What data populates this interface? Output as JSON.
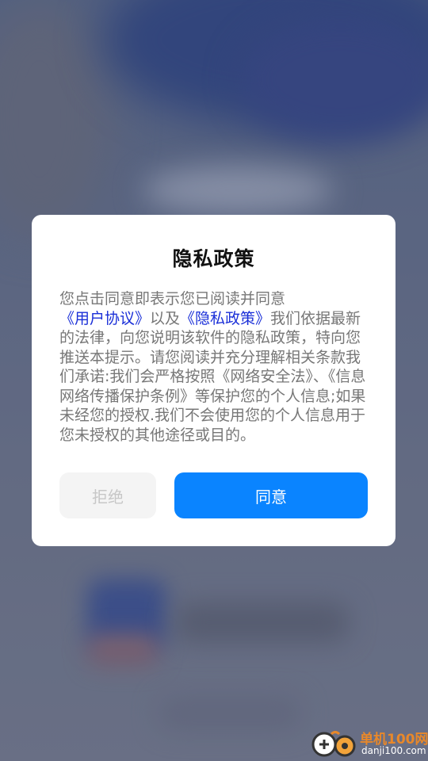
{
  "dialog": {
    "title": "隐私政策",
    "body": {
      "part1": "您点击同意即表示您已阅读并同意",
      "user_agreement_link": "《用户协议》",
      "part2": "以及",
      "privacy_policy_link": "《隐私政策》",
      "part3": "我们依据最新的法律，向您说明该软件的隐私政策，特向您推送本提示。请您阅读并充分理解相关条款我们承诺:我们会严格按照《网络安全法》、《信息网络传播保护条例》等保护您的个人信息;如果未经您的授权.我们不会使用您的个人信息用于您未授权的其他途径或目的。"
    },
    "reject_label": "拒绝",
    "agree_label": "同意"
  },
  "watermark": {
    "title": "单机100网",
    "url": "danji100.com"
  },
  "colors": {
    "agree_button": "#0a84ff",
    "link": "#1a2fd8",
    "reject_button_bg": "#f4f4f4",
    "watermark_orange": "#e8882a"
  }
}
